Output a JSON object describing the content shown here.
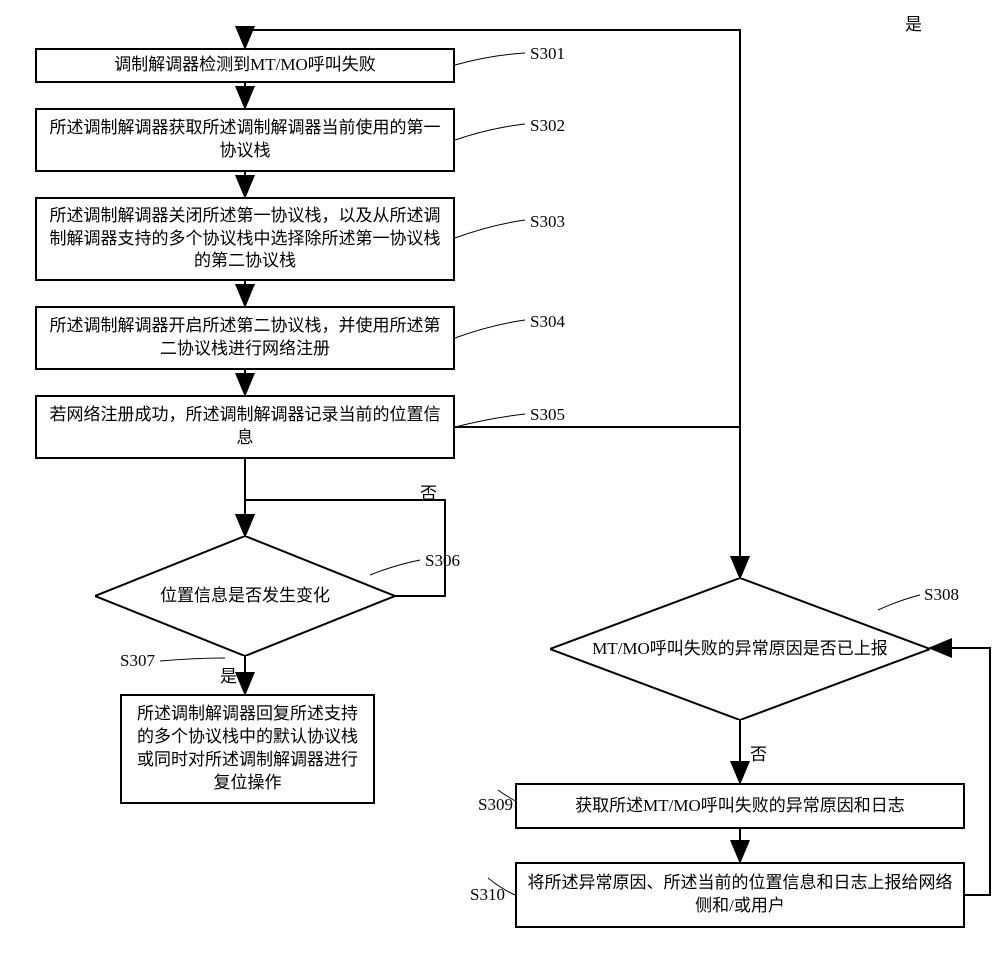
{
  "chart_data": {
    "type": "diagram",
    "nodes": [
      {
        "id": "S301",
        "shape": "rect",
        "text": "调制解调器检测到MT/MO呼叫失败"
      },
      {
        "id": "S302",
        "shape": "rect",
        "text": "所述调制解调器获取所述调制解调器当前使用的第一协议栈"
      },
      {
        "id": "S303",
        "shape": "rect",
        "text": "所述调制解调器关闭所述第一协议栈，以及从所述调制解调器支持的多个协议栈中选择除所述第一协议栈的第二协议栈"
      },
      {
        "id": "S304",
        "shape": "rect",
        "text": "所述调制解调器开启所述第二协议栈，并使用所述第二协议栈进行网络注册"
      },
      {
        "id": "S305",
        "shape": "rect",
        "text": "若网络注册成功，所述调制解调器记录当前的位置信息"
      },
      {
        "id": "S306",
        "shape": "diamond",
        "text": "位置信息是否发生变化"
      },
      {
        "id": "S307",
        "shape": "rect",
        "text": "所述调制解调器回复所述支持的多个协议栈中的默认协议栈或同时对所述调制解调器进行复位操作"
      },
      {
        "id": "S308",
        "shape": "diamond",
        "text": "MT/MO呼叫失败的异常原因是否已上报"
      },
      {
        "id": "S309",
        "shape": "rect",
        "text": "获取所述MT/MO呼叫失败的异常原因和日志"
      },
      {
        "id": "S310",
        "shape": "rect",
        "text": "将所述异常原因、所述当前的位置信息和日志上报给网络侧和/或用户"
      }
    ],
    "edges": [
      {
        "from": "S301",
        "to": "S302"
      },
      {
        "from": "S302",
        "to": "S303"
      },
      {
        "from": "S303",
        "to": "S304"
      },
      {
        "from": "S304",
        "to": "S305"
      },
      {
        "from": "S305",
        "to": "S306"
      },
      {
        "from": "S306",
        "to": "S307",
        "label": "是"
      },
      {
        "from": "S306",
        "to": "S306",
        "label": "否",
        "loop": true
      },
      {
        "from": "S305",
        "to": "S308"
      },
      {
        "from": "S308",
        "to": "S309",
        "label": "否"
      },
      {
        "from": "S308",
        "to": "S301",
        "label": "是",
        "loop": true
      },
      {
        "from": "S309",
        "to": "S310"
      },
      {
        "from": "S310",
        "to": "S308",
        "loop": true
      }
    ]
  },
  "steps": {
    "s301": {
      "label": "S301",
      "text": "调制解调器检测到MT/MO呼叫失败"
    },
    "s302": {
      "label": "S302",
      "text": "所述调制解调器获取所述调制解调器当前使用的第一协议栈"
    },
    "s303": {
      "label": "S303",
      "text": "所述调制解调器关闭所述第一协议栈，以及从所述调制解调器支持的多个协议栈中选择除所述第一协议栈的第二协议栈"
    },
    "s304": {
      "label": "S304",
      "text": "所述调制解调器开启所述第二协议栈，并使用所述第二协议栈进行网络注册"
    },
    "s305": {
      "label": "S305",
      "text": "若网络注册成功，所述调制解调器记录当前的位置信息"
    },
    "s306": {
      "label": "S306",
      "text": "位置信息是否发生变化"
    },
    "s307": {
      "label": "S307",
      "text": "所述调制解调器回复所述支持的多个协议栈中的默认协议栈或同时对所述调制解调器进行复位操作"
    },
    "s308": {
      "label": "S308",
      "text": "MT/MO呼叫失败的异常原因是否已上报"
    },
    "s309": {
      "label": "S309",
      "text": "获取所述MT/MO呼叫失败的异常原因和日志"
    },
    "s310": {
      "label": "S310",
      "text": "将所述异常原因、所述当前的位置信息和日志上报给网络侧和/或用户"
    }
  },
  "yn": {
    "yes": "是",
    "no": "否"
  }
}
